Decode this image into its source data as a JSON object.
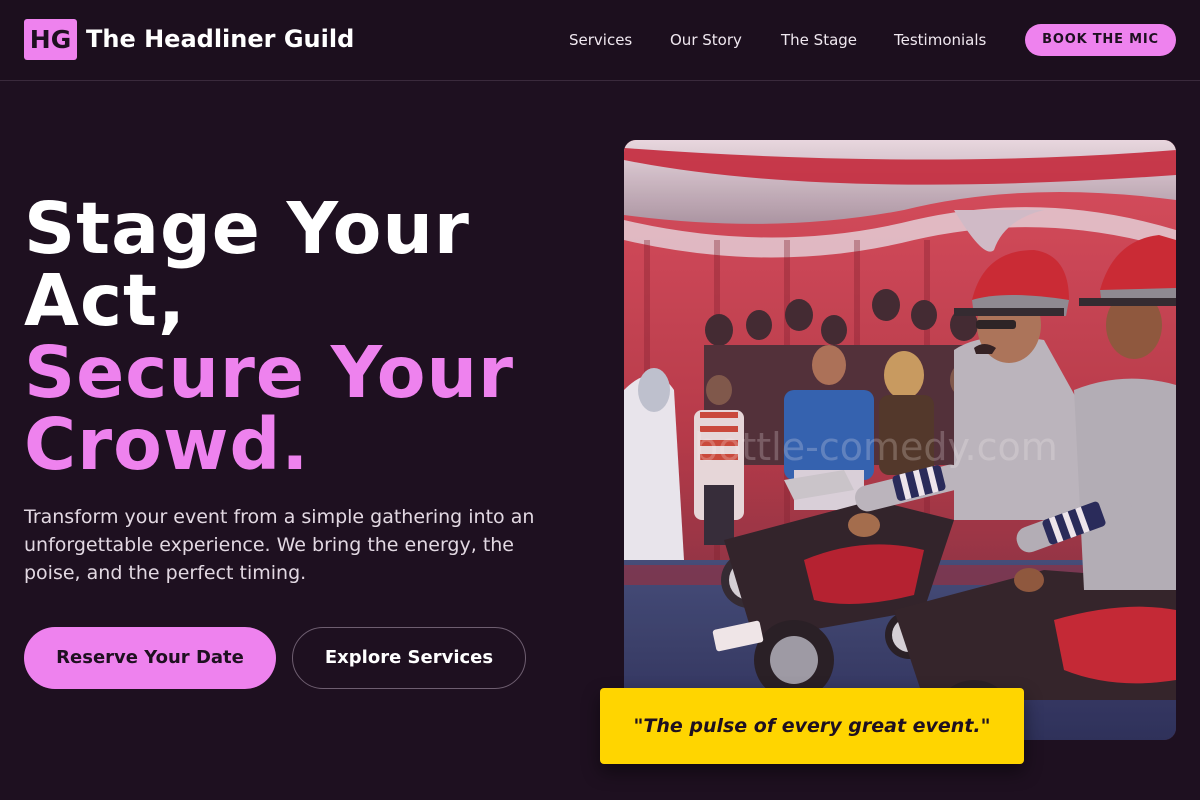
{
  "header": {
    "logo_initials": "HG",
    "brand_name": "The Headliner Guild",
    "nav": {
      "services": "Services",
      "our_story": "Our Story",
      "the_stage": "The Stage",
      "testimonials": "Testimonials"
    },
    "book_button": "BOOK THE MIC"
  },
  "hero": {
    "headline_white_1": "Stage Your",
    "headline_white_2": "Act,",
    "headline_pink_1": "Secure Your",
    "headline_pink_2": "Crowd.",
    "description": "Transform your event from a simple gathering into an unforgettable experience. We bring the energy, the poise, and the perfect timing.",
    "primary_cta": "Reserve Your Date",
    "secondary_cta": "Explore Services",
    "image_watermark": "bottle-comedy.com",
    "quote": "\"The pulse of every great event.\""
  },
  "colors": {
    "background": "#1e1020",
    "accent_pink": "#ee82ee",
    "quote_yellow": "#ffd500"
  },
  "icons": {
    "logo": "hg-monogram-badge"
  }
}
